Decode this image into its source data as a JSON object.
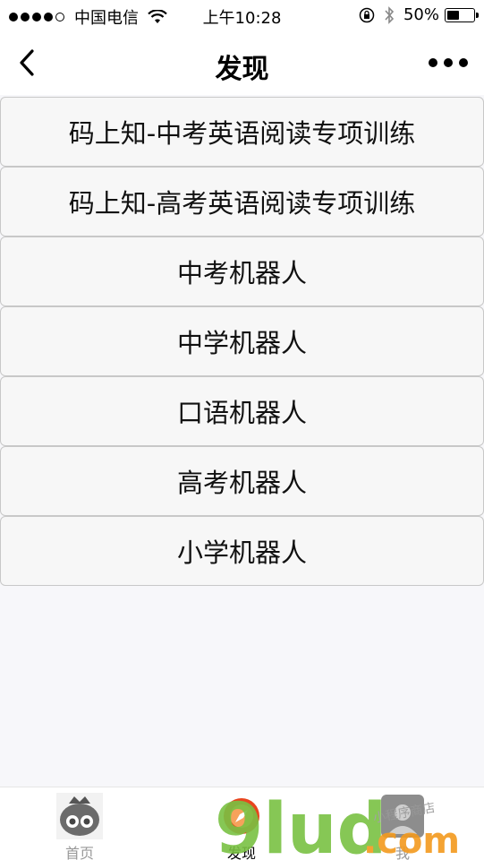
{
  "status_bar": {
    "carrier": "中国电信",
    "time": "上午10:28",
    "battery": "50%",
    "battery_level": 0.5
  },
  "nav": {
    "title": "发现",
    "back_icon": "chevron-left-icon",
    "more_icon": "more-dots-icon"
  },
  "menu": {
    "items": [
      {
        "label": "码上知-中考英语阅读专项训练"
      },
      {
        "label": "码上知-高考英语阅读专项训练"
      },
      {
        "label": "中考机器人"
      },
      {
        "label": "中学机器人"
      },
      {
        "label": "口语机器人"
      },
      {
        "label": "高考机器人"
      },
      {
        "label": "小学机器人"
      }
    ]
  },
  "tab_bar": {
    "tabs": [
      {
        "label": "首页",
        "icon": "home-mascot-icon",
        "active": false
      },
      {
        "label": "发现",
        "icon": "discover-icon",
        "active": true
      },
      {
        "label": "我",
        "icon": "profile-icon",
        "active": false
      }
    ]
  },
  "watermark": {
    "brand": "9lud",
    "suffix": ".com",
    "text": "小程序商店",
    "colors": {
      "green": "#7ac143",
      "orange": "#f39a1e"
    }
  }
}
